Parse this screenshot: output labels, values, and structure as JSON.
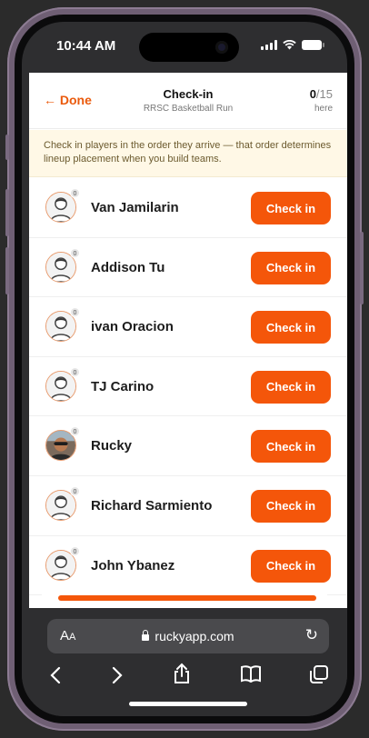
{
  "status": {
    "time": "10:44 AM"
  },
  "header": {
    "back_label": "← Done",
    "title": "Check-in",
    "subtitle": "RRSC Basketball Run",
    "checked_in": "0",
    "total": "/15",
    "count_label": "here"
  },
  "banner": {
    "text": "Check in players in the order they arrive — that order determines lineup placement when you build teams."
  },
  "players": [
    {
      "name": "Van Jamilarin",
      "badge": "0",
      "button": "Check in",
      "avatar": "default-avatar"
    },
    {
      "name": "Addison Tu",
      "badge": "0",
      "button": "Check in",
      "avatar": "default-avatar"
    },
    {
      "name": "ivan Oracion",
      "badge": "0",
      "button": "Check in",
      "avatar": "default-avatar"
    },
    {
      "name": "TJ Carino",
      "badge": "0",
      "button": "Check in",
      "avatar": "default-avatar"
    },
    {
      "name": "Rucky",
      "badge": "0",
      "button": "Check in",
      "avatar": "photo-avatar"
    },
    {
      "name": "Richard Sarmiento",
      "badge": "0",
      "button": "Check in",
      "avatar": "default-avatar"
    },
    {
      "name": "John Ybanez",
      "badge": "0",
      "button": "Check in",
      "avatar": "default-avatar"
    }
  ],
  "browser": {
    "aa": "A",
    "aa_small": "A",
    "url": "ruckyapp.com"
  },
  "colors": {
    "accent": "#f4560a",
    "link": "#ea5a0c",
    "banner_bg": "#fff8e6"
  }
}
